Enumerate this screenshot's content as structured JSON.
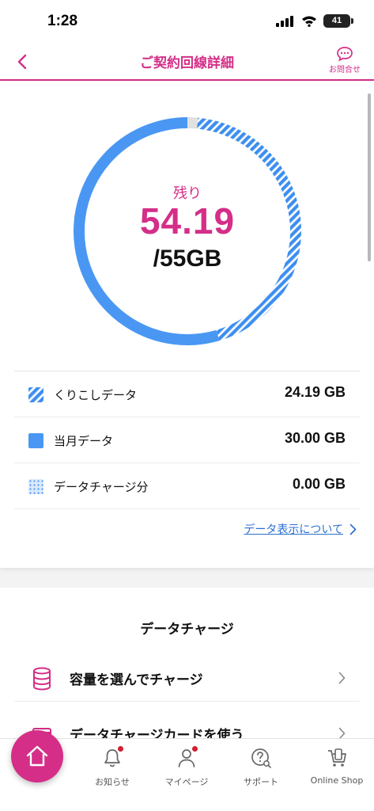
{
  "status_bar": {
    "time": "1:28",
    "battery": "41"
  },
  "header": {
    "title": "ご契約回線詳細",
    "contact_label": "お問合せ"
  },
  "summary": {
    "remaining_label": "残り",
    "remaining_value": "54.19",
    "total_value": "/55GB"
  },
  "chart_data": {
    "type": "donut",
    "unit": "GB",
    "total": 55,
    "remaining": 54.19,
    "segments": [
      {
        "name": "くりこしデータ",
        "value": 24.19,
        "color": "#3d8fef",
        "pattern": "stripes"
      },
      {
        "name": "当月データ",
        "value": 30.0,
        "color": "#4a97f3",
        "pattern": "solid"
      },
      {
        "name": "データチャージ分",
        "value": 0.0,
        "color": "#b7d4fb",
        "pattern": "dots"
      }
    ],
    "used_color": "#e1e1e1"
  },
  "legend": {
    "items": [
      {
        "label": "くりこしデータ",
        "amount": "24.19 GB"
      },
      {
        "label": "当月データ",
        "amount": "30.00 GB"
      },
      {
        "label": "データチャージ分",
        "amount": "0.00 GB"
      }
    ]
  },
  "data_display_link": "データ表示について",
  "charge": {
    "title": "データチャージ",
    "items": [
      {
        "label": "容量を選んでチャージ"
      },
      {
        "label": "データチャージカードを使う"
      }
    ]
  },
  "nav": {
    "home_icon": "home-icon",
    "items": [
      {
        "label": "お知らせ",
        "icon": "bell-icon",
        "badge": true
      },
      {
        "label": "マイページ",
        "icon": "person-icon",
        "badge": true
      },
      {
        "label": "サポート",
        "icon": "support-icon",
        "badge": false
      },
      {
        "label": "Online Shop",
        "icon": "shop-icon",
        "badge": false
      }
    ]
  },
  "colors": {
    "accent": "#d42e88",
    "chart_blue": "#4a97f3",
    "link": "#2a6fd0"
  }
}
